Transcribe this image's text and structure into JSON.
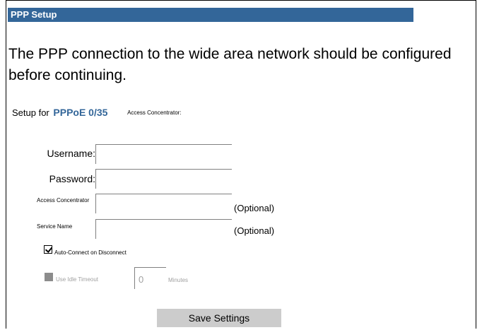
{
  "header": {
    "title": "PPP Setup"
  },
  "intro": {
    "text": "The PPP connection to the wide area network should be configured before continuing."
  },
  "setup": {
    "prefix": "Setup for",
    "protocol": "PPPoE 0/35",
    "access_concentrator_label": "Access Concentrator:"
  },
  "form": {
    "username_label": "Username:",
    "username_value": "",
    "password_label": "Password:",
    "password_value": "",
    "access_concentrator_label": "Access Concentrator",
    "access_concentrator_value": "",
    "access_concentrator_note": "(Optional)",
    "service_name_label": "Service Name",
    "service_name_value": "",
    "service_name_note": "(Optional)",
    "auto_connect_label": "Auto-Connect on Disconnect",
    "auto_connect_checked": true,
    "idle_timeout_label": "Use Idle Timeout",
    "idle_timeout_checked": false,
    "idle_timeout_value": "0",
    "idle_timeout_unit": "Minutes"
  },
  "actions": {
    "save_label": "Save Settings"
  },
  "colors": {
    "header_bg": "#336699",
    "accent_text": "#336699",
    "button_bg": "#cccccc",
    "disabled_text": "#a0a0a0"
  }
}
